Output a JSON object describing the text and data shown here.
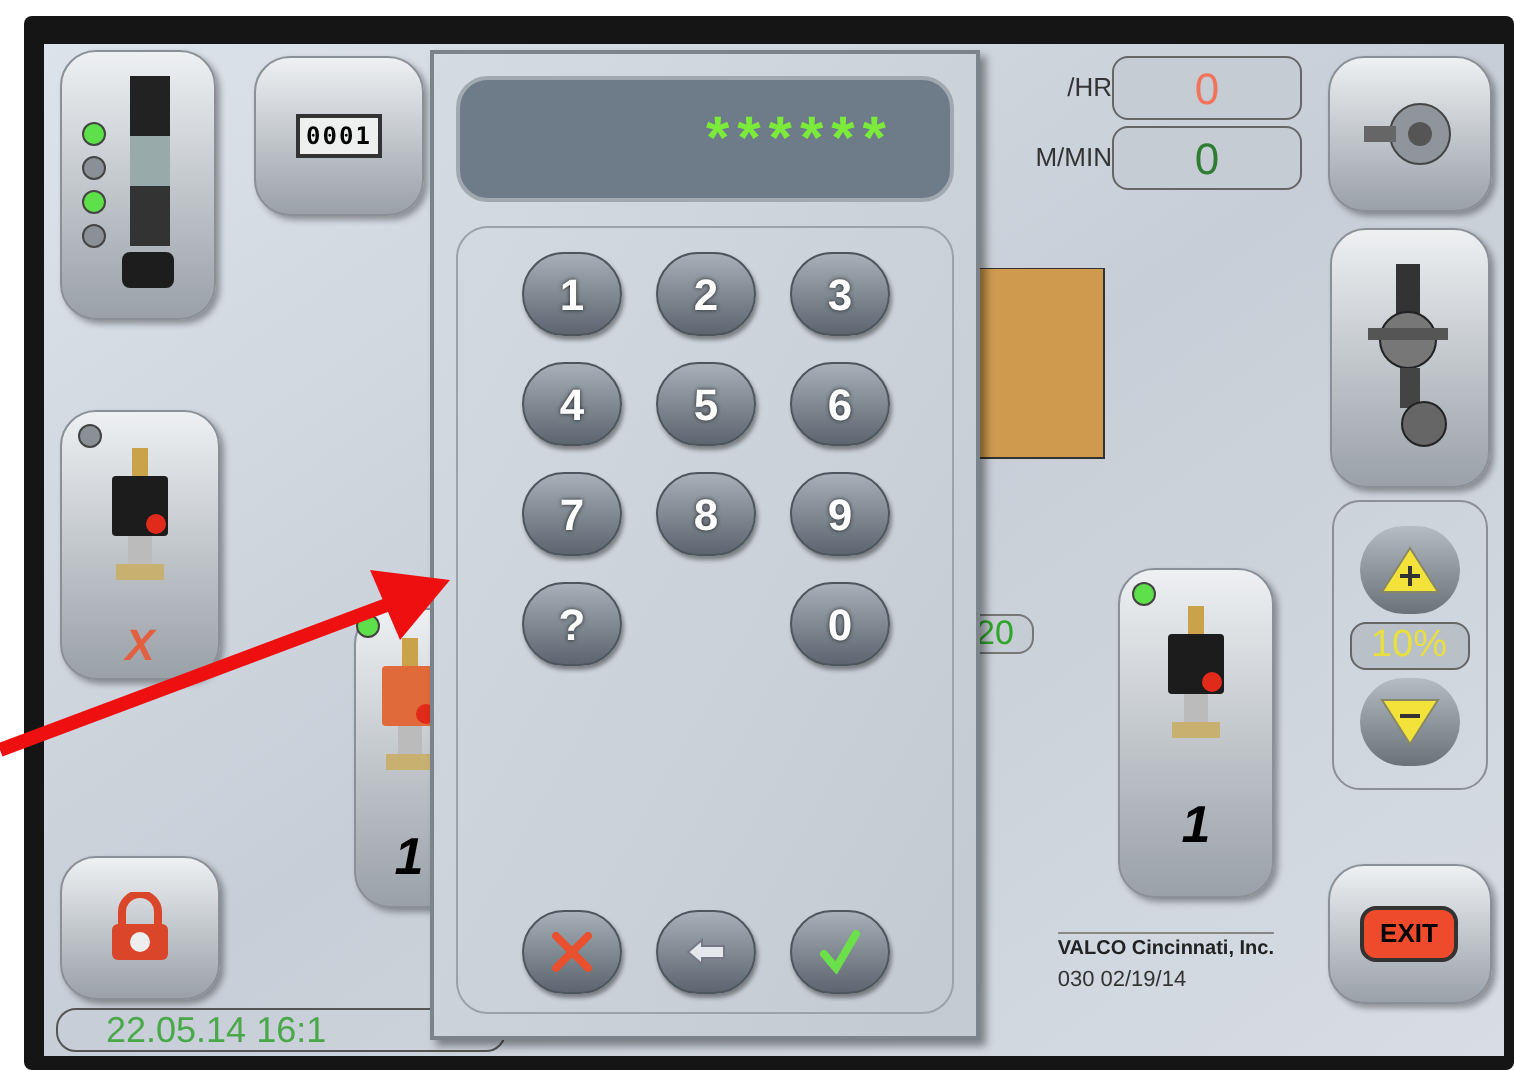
{
  "counter": "0001",
  "status_leds": [
    {
      "on": true
    },
    {
      "on": false
    },
    {
      "on": true
    },
    {
      "on": false
    }
  ],
  "valve_left": {
    "led_on": false,
    "status": "X"
  },
  "valve_middle": {
    "led_on": true,
    "count": "1"
  },
  "valve_right": {
    "led_on": true,
    "count": "1"
  },
  "rate": {
    "label": "/HR",
    "value": "0"
  },
  "speed": {
    "label": "M/MIN",
    "value": "0"
  },
  "partial_reading": "20",
  "adjust": {
    "value": "10%"
  },
  "exit_button": "EXIT",
  "datetime": "22.05.14 16:1",
  "footer": {
    "company": "VALCO Cincinnati, Inc.",
    "version": "030 02/19/14"
  },
  "keypad": {
    "entry": "******",
    "keys": [
      {
        "kind": "digit",
        "label": "1"
      },
      {
        "kind": "digit",
        "label": "2"
      },
      {
        "kind": "digit",
        "label": "3"
      },
      {
        "kind": "digit",
        "label": "4"
      },
      {
        "kind": "digit",
        "label": "5"
      },
      {
        "kind": "digit",
        "label": "6"
      },
      {
        "kind": "digit",
        "label": "7"
      },
      {
        "kind": "digit",
        "label": "8"
      },
      {
        "kind": "digit",
        "label": "9"
      },
      {
        "kind": "digit",
        "label": "?"
      },
      {
        "kind": "blank"
      },
      {
        "kind": "digit",
        "label": "0"
      }
    ],
    "actions": [
      {
        "kind": "cancel"
      },
      {
        "kind": "backspace"
      },
      {
        "kind": "confirm"
      }
    ]
  }
}
